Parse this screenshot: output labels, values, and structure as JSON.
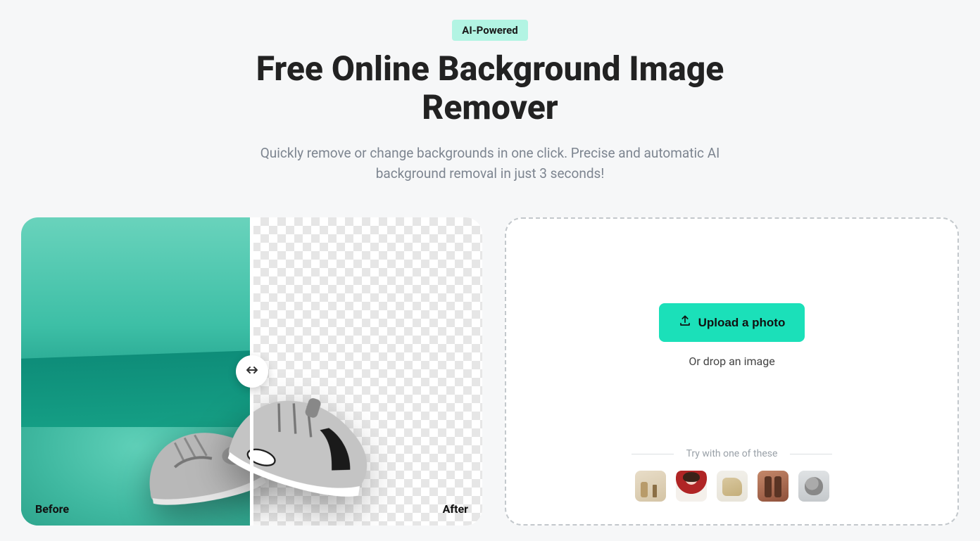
{
  "badge": "AI-Powered",
  "title": "Free Online Background Image Remover",
  "subtitle": "Quickly remove or change backgrounds in one click. Precise and automatic AI background removal in just 3 seconds!",
  "compare": {
    "before_label": "Before",
    "after_label": "After"
  },
  "upload": {
    "button_label": "Upload a photo",
    "drop_text": "Or drop an image",
    "try_label": "Try with one of these"
  }
}
